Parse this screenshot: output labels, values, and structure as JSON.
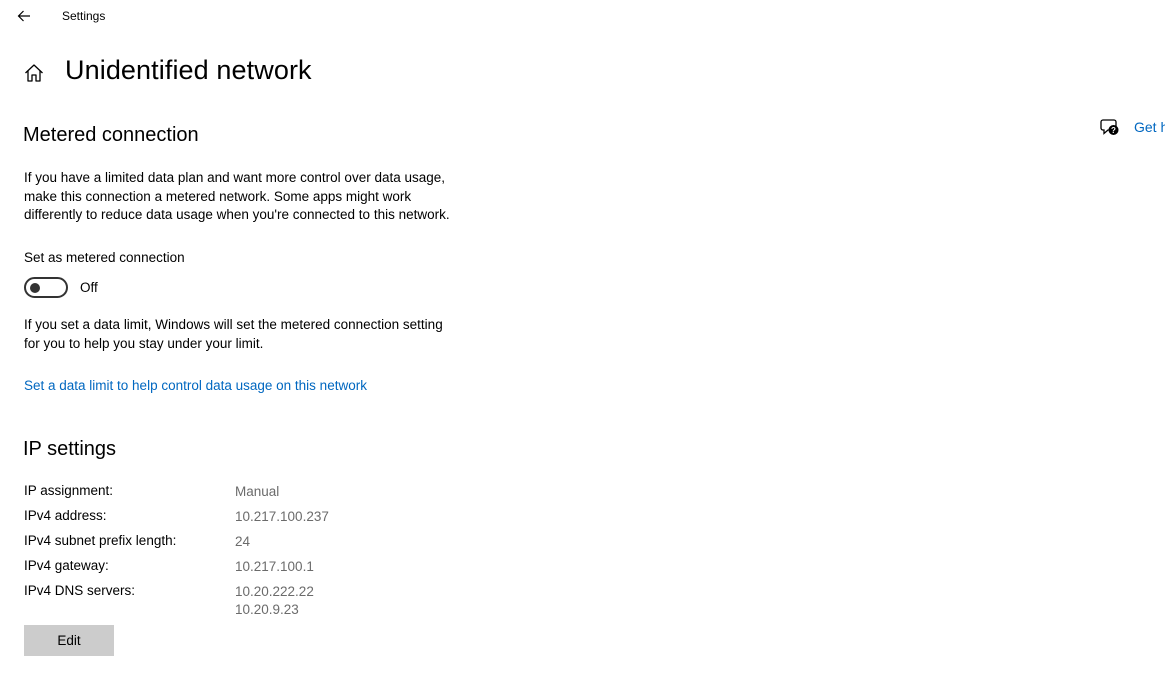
{
  "window": {
    "title": "Settings"
  },
  "header": {
    "title": "Unidentified network"
  },
  "help": {
    "label": "Get help",
    "icon": "help-chat-icon"
  },
  "metered": {
    "heading": "Metered connection",
    "description_lines": [
      "If you have a limited data plan and want more control over data usage,",
      "make this connection a metered network. Some apps might work",
      "differently to reduce data usage when you're connected to this network."
    ],
    "toggle_label": "Set as metered connection",
    "toggle_state": "Off",
    "limit_lines": [
      "If you set a data limit, Windows will set the metered connection setting",
      "for you to help you stay under your limit."
    ],
    "limit_link": "Set a data limit to help control data usage on this network"
  },
  "ip": {
    "heading": "IP settings",
    "rows": [
      {
        "key": "IP assignment:",
        "value": "Manual"
      },
      {
        "key": "IPv4 address:",
        "value": "10.217.100.237"
      },
      {
        "key": "IPv4 subnet prefix length:",
        "value": "24"
      },
      {
        "key": "IPv4 gateway:",
        "value": "10.217.100.1"
      },
      {
        "key": "IPv4 DNS servers:",
        "value": "10.20.222.22",
        "value2": "10.20.9.23"
      }
    ],
    "edit_label": "Edit"
  },
  "colors": {
    "accent": "#0067c0",
    "secondary_text": "#6b6b6b",
    "button_bg": "#cccccc"
  }
}
